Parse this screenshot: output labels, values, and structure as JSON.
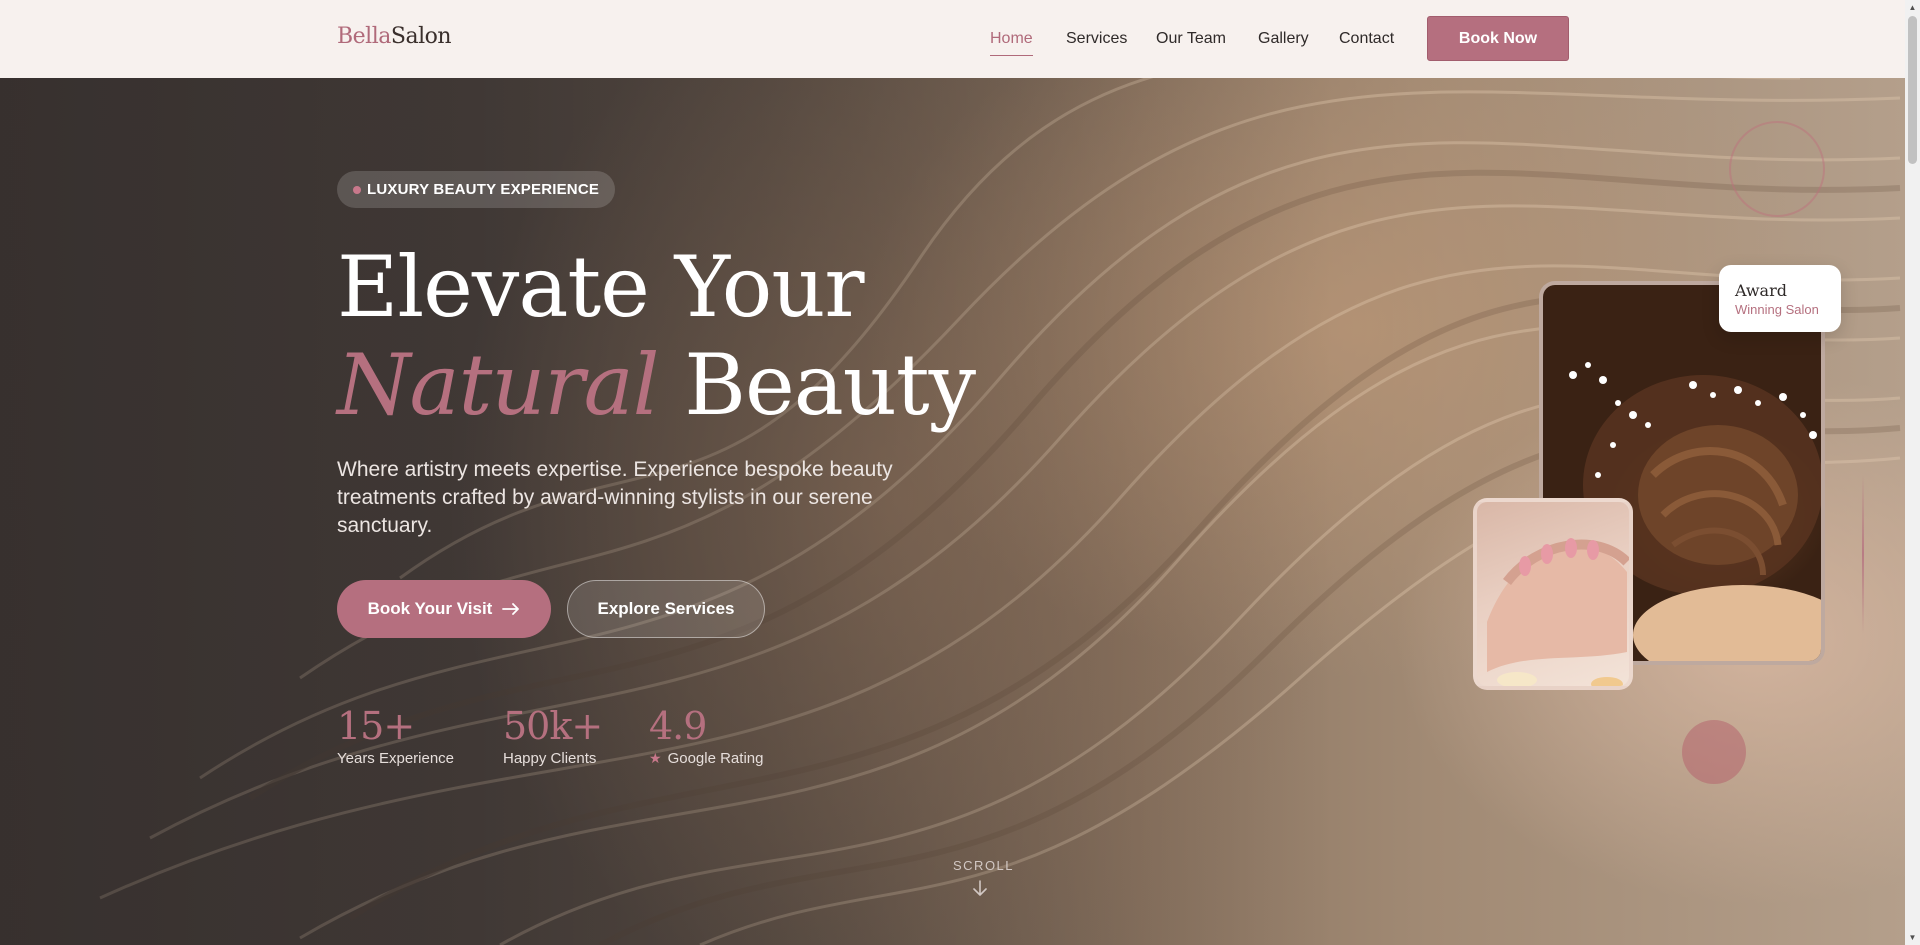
{
  "nav": {
    "logo_accent": "Bella",
    "logo_main": "Salon",
    "links": [
      {
        "label": "Home",
        "active": true
      },
      {
        "label": "Services",
        "active": false
      },
      {
        "label": "Our Team",
        "active": false
      },
      {
        "label": "Gallery",
        "active": false
      },
      {
        "label": "Contact",
        "active": false
      }
    ],
    "cta": "Book Now"
  },
  "hero": {
    "badge": "LUXURY BEAUTY EXPERIENCE",
    "headline_line1": "Elevate Your",
    "headline_italic": "Natural",
    "headline_line2_rest": "Beauty",
    "subtitle": "Where artistry meets expertise. Experience bespoke beauty treatments crafted by award-winning stylists in our serene sanctuary.",
    "primary_button": "Book Your Visit",
    "secondary_button": "Explore Services",
    "stats": [
      {
        "value": "15+",
        "label": "Years Experience"
      },
      {
        "value": "50k+",
        "label": "Happy Clients"
      },
      {
        "value": "4.9",
        "label": "Google Rating"
      }
    ],
    "scroll_label": "SCROLL"
  },
  "award": {
    "title": "Award",
    "subtitle": "Winning Salon"
  },
  "colors": {
    "accent": "#b56f7f",
    "nav_bg": "#f7f1ee",
    "text_dark": "#2f2a29"
  },
  "icons": {
    "arrow": "arrow-right-icon",
    "star": "star-icon",
    "scroll": "arrow-down-icon"
  }
}
